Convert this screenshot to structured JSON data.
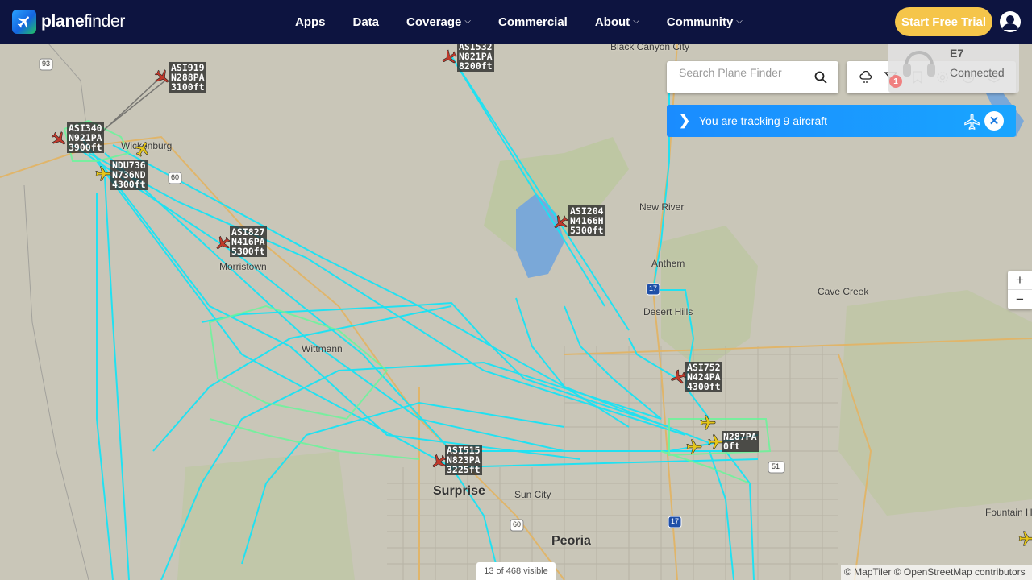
{
  "brand": {
    "name_bold": "plane",
    "name_thin": "finder"
  },
  "nav": {
    "items": [
      {
        "label": "Apps",
        "dropdown": false
      },
      {
        "label": "Data",
        "dropdown": false
      },
      {
        "label": "Coverage",
        "dropdown": true
      },
      {
        "label": "Commercial",
        "dropdown": false
      },
      {
        "label": "About",
        "dropdown": true
      },
      {
        "label": "Community",
        "dropdown": true
      }
    ],
    "cta": "Start Free Trial"
  },
  "search": {
    "placeholder": "Search Plane Finder"
  },
  "toolbar": {
    "tools": [
      "weather-icon",
      "filter-icon",
      "bookmark-icon",
      "settings-icon",
      "history-icon",
      "layers-icon"
    ],
    "filter_badge": "1"
  },
  "atc": {
    "code": "E7",
    "status": "Connected"
  },
  "tracking": {
    "text": "You are tracking 9 aircraft"
  },
  "zoom": {
    "in": "+",
    "out": "−"
  },
  "footer": {
    "visible_count": "13 of 468 visible",
    "attribution": "© MapTiler © OpenStreetMap contributors"
  },
  "places": [
    {
      "name": "Black Canyon City",
      "big": false
    },
    {
      "name": "Wickenburg",
      "big": false
    },
    {
      "name": "Morristown",
      "big": false
    },
    {
      "name": "Wittmann",
      "big": false
    },
    {
      "name": "New River",
      "big": false
    },
    {
      "name": "Anthem",
      "big": false
    },
    {
      "name": "Cave Creek",
      "big": false
    },
    {
      "name": "Desert Hills",
      "big": false
    },
    {
      "name": "Surprise",
      "big": true
    },
    {
      "name": "Sun City",
      "big": false
    },
    {
      "name": "Peoria",
      "big": true
    },
    {
      "name": "Fountain H",
      "big": false
    }
  ],
  "highways": [
    "93",
    "60",
    "17",
    "60",
    "17",
    "51"
  ],
  "aircraft": [
    {
      "callsign": "ASI532",
      "reg": "N821PA",
      "alt": "8200ft",
      "color": "#c0392b"
    },
    {
      "callsign": "ASI919",
      "reg": "N288PA",
      "alt": "3100ft",
      "color": "#c0392b"
    },
    {
      "callsign": "ASI340",
      "reg": "N921PA",
      "alt": "3900ft",
      "color": "#c0392b"
    },
    {
      "callsign": "NDU736",
      "reg": "N736ND",
      "alt": "4300ft",
      "color": "#e6c619"
    },
    {
      "callsign": "ASI827",
      "reg": "N416PA",
      "alt": "5300ft",
      "color": "#c0392b"
    },
    {
      "callsign": "ASI204",
      "reg": "N4166H",
      "alt": "5300ft",
      "color": "#c0392b"
    },
    {
      "callsign": "ASI752",
      "reg": "N424PA",
      "alt": "4300ft",
      "color": "#c0392b"
    },
    {
      "callsign": "",
      "reg": "N287PA",
      "alt": "0ft",
      "color": "#e6c619"
    },
    {
      "callsign": "ASI515",
      "reg": "N823PA",
      "alt": "3225ft",
      "color": "#c0392b"
    }
  ],
  "colors": {
    "nav_bg": "#0d1440",
    "cta": "#f5c54a",
    "track": "#19e3f5",
    "track_alt": "#6af59a",
    "tracking_bar": "#1a8cff"
  }
}
